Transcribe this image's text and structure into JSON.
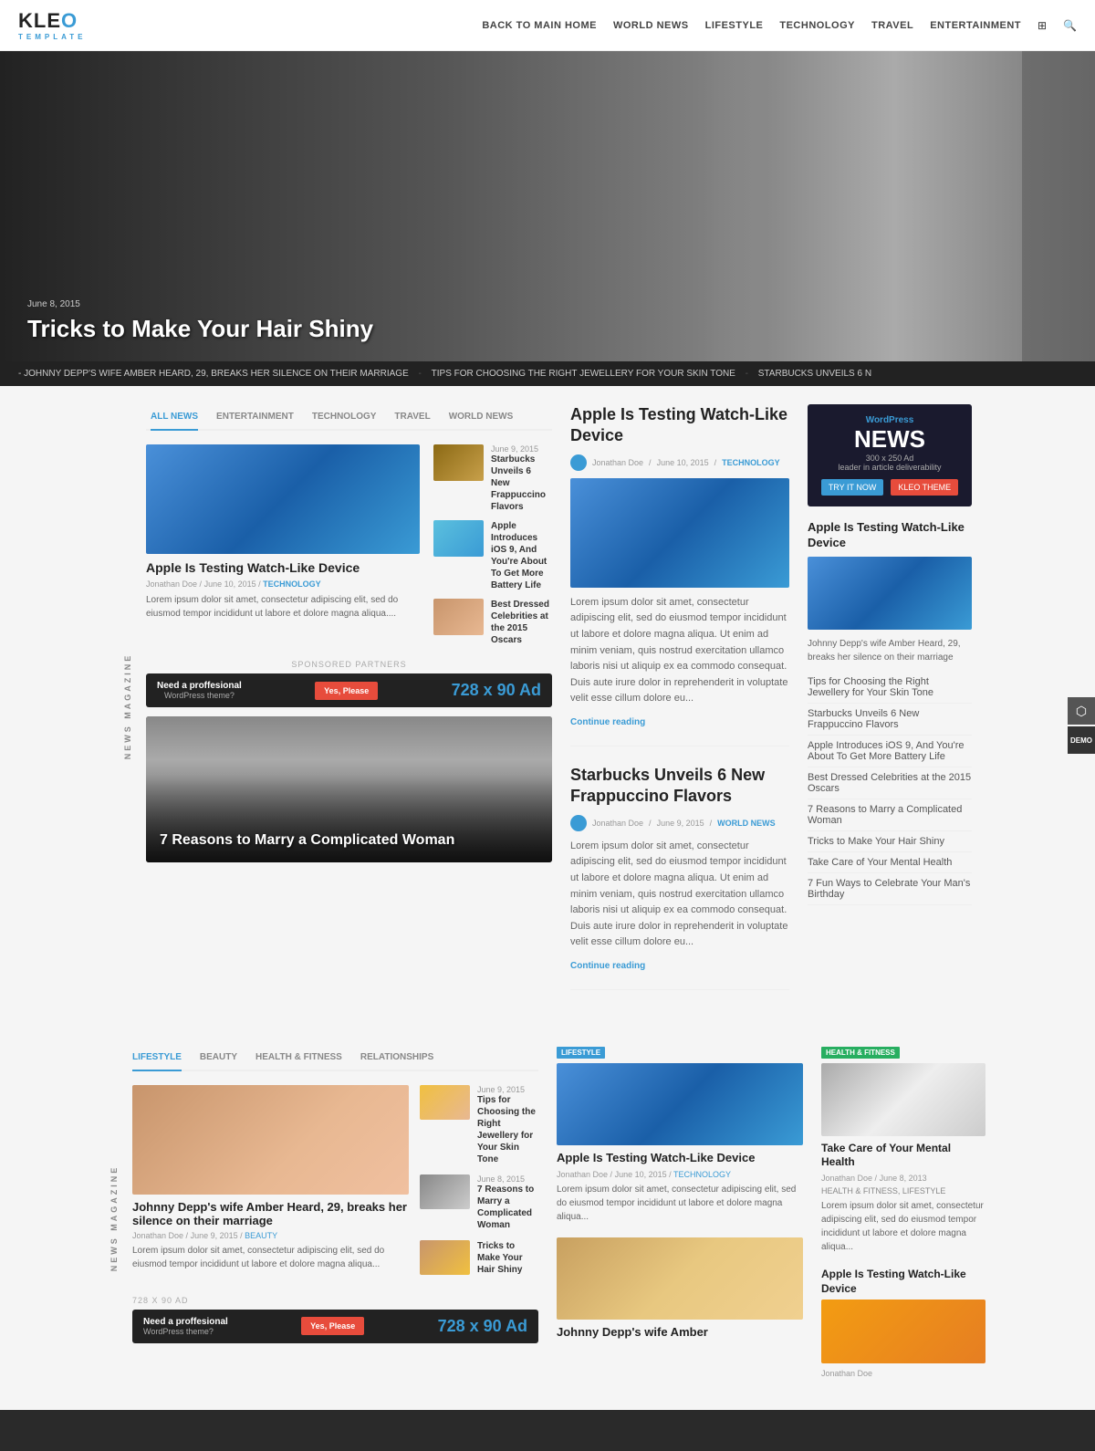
{
  "header": {
    "logo_text": "KLEO",
    "logo_accent": "O",
    "logo_sub": "TEMPLATE",
    "nav_items": [
      {
        "label": "Back to Main Home",
        "href": "#"
      },
      {
        "label": "WORLD NEWS",
        "href": "#"
      },
      {
        "label": "LIFESTYLE",
        "href": "#"
      },
      {
        "label": "TECHNOLOGY",
        "href": "#"
      },
      {
        "label": "TRAVEL",
        "href": "#"
      },
      {
        "label": "ENTERTAINMENT",
        "href": "#"
      }
    ]
  },
  "hero": {
    "date": "June 8, 2015",
    "title": "Tricks to Make Your Hair Shiny"
  },
  "ticker": {
    "items": [
      "JOHNNY DEPP'S WIFE AMBER HEARD, 29, BREAKS HER SILENCE ON THEIR MARRIAGE",
      "TIPS FOR CHOOSING THE RIGHT JEWELLERY FOR YOUR SKIN TONE",
      "STARBUCKS UNVEILS 6 N"
    ]
  },
  "tabs": {
    "items": [
      "ALL NEWS",
      "ENTERTAINMENT",
      "TECHNOLOGY",
      "TRAVEL",
      "WORLD NEWS"
    ],
    "active": "ALL NEWS"
  },
  "main_articles": {
    "featured": {
      "title": "Apple Is Testing Watch-Like Device",
      "meta_author": "Jonathan Doe",
      "meta_date": "June 10, 2015",
      "meta_cat": "TECHNOLOGY",
      "excerpt": "Lorem ipsum dolor sit amet, consectetur adipiscing elit, sed do eiusmod tempor incididunt ut labore et dolore magna aliqua...."
    },
    "side_items": [
      {
        "date": "June 9, 2015",
        "title": "Starbucks Unveils 6 New Frappuccino Flavors"
      },
      {
        "date": "",
        "title": "Apple Introduces iOS 9, And You're About To Get More Battery Life"
      },
      {
        "date": "",
        "title": "Best Dressed Celebrities at the 2015 Oscars"
      }
    ]
  },
  "sponsored": {
    "label": "SPONSORED PARTNERS"
  },
  "ad_banner": {
    "text": "Need a proffesional",
    "sub": "WordPress theme?",
    "btn": "Yes, Please",
    "number": "728 x 90 Ad"
  },
  "feature_card": {
    "title": "7 Reasons to Marry a Complicated Woman"
  },
  "center_articles": [
    {
      "title": "Apple Is Testing Watch-Like Device",
      "author": "Jonathan Doe",
      "date": "June 10, 2015",
      "cat": "TECHNOLOGY",
      "excerpt": "Lorem ipsum dolor sit amet, consectetur adipiscing elit, sed do eiusmod tempor incididunt ut labore et dolore magna aliqua. Ut enim ad minim veniam, quis nostrud exercitation ullamco laboris nisi ut aliquip ex ea commodo consequat. Duis aute irure dolor in reprehenderit in voluptate velit esse cillum dolore eu...",
      "continue": "Continue reading"
    },
    {
      "title": "Starbucks Unveils 6 New Frappuccino Flavors",
      "author": "Jonathan Doe",
      "date": "June 9, 2015",
      "cat": "WORLD NEWS",
      "excerpt": "Lorem ipsum dolor sit amet, consectetur adipiscing elit, sed do eiusmod tempor incididunt ut labore et dolore magna aliqua. Ut enim ad minim veniam, quis nostrud exercitation ullamco laboris nisi ut aliquip ex ea commodo consequat. Duis aute irure dolor in reprehenderit in voluptate velit esse cillum dolore eu...",
      "continue": "Continue reading"
    }
  ],
  "sidebar": {
    "ad": {
      "label": "WordPress",
      "title": "NEWS",
      "size": "300 x 250 Ad",
      "desc": "leader in article deliverability",
      "try_btn": "TRY IT NOW",
      "kleo_btn": "KLEO THEME"
    },
    "article": {
      "title": "Apple Is Testing Watch-Like Device",
      "desc": "Johnny Depp's wife Amber Heard, 29, breaks her silence on their marriage"
    },
    "links": [
      "Tips for Choosing the Right Jewellery for Your Skin Tone",
      "Starbucks Unveils 6 New Frappuccino Flavors",
      "Apple Introduces iOS 9, And You're About To Get More Battery Life",
      "Best Dressed Celebrities at the 2015 Oscars",
      "7 Reasons to Marry a Complicated Woman",
      "Tricks to Make Your Hair Shiny",
      "Take Care of Your Mental Health",
      "7 Fun Ways to Celebrate Your Man's Birthday"
    ]
  },
  "lifestyle": {
    "tabs": [
      "LIFESTYLE",
      "BEAUTY",
      "HEALTH & FITNESS",
      "RELATIONSHIPS"
    ],
    "active": "LIFESTYLE",
    "main_article": {
      "title": "Johnny Depp's wife Amber Heard, 29, breaks her silence on their marriage",
      "author": "Jonathan Doe",
      "date": "June 9, 2015",
      "cat": "BEAUTY",
      "excerpt": "Lorem ipsum dolor sit amet, consectetur adipiscing elit, sed do eiusmod tempor incididunt ut labore et dolore magna aliqua..."
    },
    "side_items": [
      {
        "date": "June 9, 2015",
        "title": "Tips for Choosing the Right Jewellery for Your Skin Tone"
      },
      {
        "date": "June 8, 2015",
        "title": "7 Reasons to Marry a Complicated Woman"
      },
      {
        "date": "",
        "title": "Tricks to Make Your Hair Shiny"
      }
    ]
  },
  "section2_center": [
    {
      "badge": "LIFESTYLE",
      "badge_color": "blue",
      "title": "Apple Is Testing Watch-Like Device",
      "author": "Jonathan Doe",
      "date": "June 10, 2015",
      "cat": "TECHNOLOGY",
      "excerpt": "Lorem ipsum dolor sit amet, consectetur adipiscing elit, sed do eiusmod tempor incididunt ut labore et dolore magna aliqua..."
    },
    {
      "badge": "",
      "badge_color": "",
      "title": "Johnny Depp's wife Amber",
      "author": "",
      "date": "",
      "cat": "",
      "excerpt": ""
    }
  ],
  "section2_right": {
    "badge": "HEALTH & FITNESS",
    "title": "Take Care of Your Mental Health",
    "author": "Jonathan Doe",
    "date": "June 8, 2013",
    "cat": "HEALTH & FITNESS, LIFESTYLE",
    "excerpt": "Lorem ipsum dolor sit amet, consectetur adipiscing elit, sed do eiusmod tempor incididunt ut labore et dolore magna aliqua...",
    "title2": "Apple Is Testing Watch-Like Device",
    "name2": "Jonathan Doe"
  },
  "bottom_ad": {
    "text": "Need a proffesional",
    "sub": "WordPress theme?",
    "btn": "Yes, Please",
    "number": "728 x 90 Ad"
  }
}
